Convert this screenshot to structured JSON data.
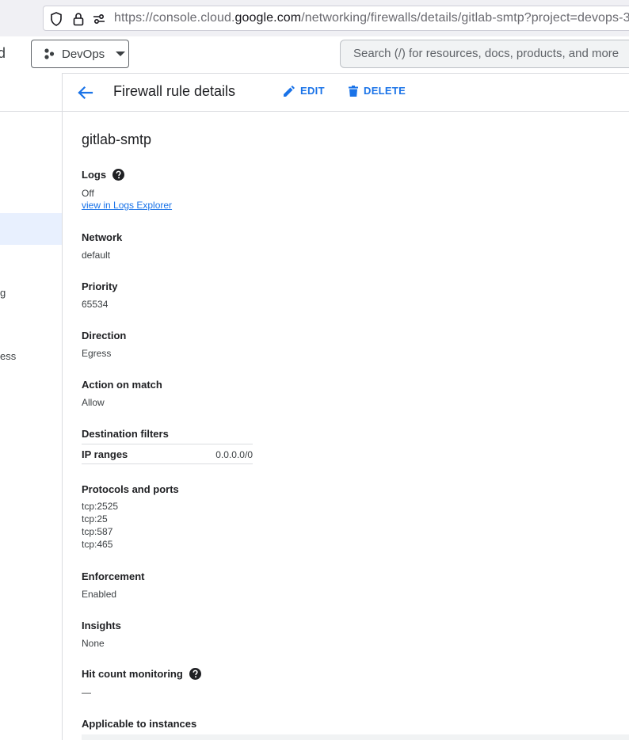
{
  "browser": {
    "url_prefix": "https://console.cloud.",
    "url_domain": "google.com",
    "url_suffix": "/networking/firewalls/details/gitlab-smtp?project=devops-3"
  },
  "header": {
    "truncated_brand": "d",
    "project_label": "DevOps",
    "search_placeholder": "Search (/) for resources, docs, products, and more"
  },
  "leftnav": {
    "fragments": [
      "g",
      "ess"
    ]
  },
  "titlebar": {
    "title": "Firewall rule details",
    "edit_label": "EDIT",
    "delete_label": "DELETE"
  },
  "rule": {
    "name": "gitlab-smtp",
    "logs_label": "Logs",
    "logs_value": "Off",
    "logs_link": "view in Logs Explorer",
    "network_label": "Network",
    "network_value": "default",
    "priority_label": "Priority",
    "priority_value": "65534",
    "direction_label": "Direction",
    "direction_value": "Egress",
    "action_label": "Action on match",
    "action_value": "Allow",
    "dest_filters_label": "Destination filters",
    "ip_ranges_key": "IP ranges",
    "ip_ranges_value": "0.0.0.0/0",
    "protocols_label": "Protocols and ports",
    "protocols": [
      "tcp:2525",
      "tcp:25",
      "tcp:587",
      "tcp:465"
    ],
    "enforcement_label": "Enforcement",
    "enforcement_value": "Enabled",
    "insights_label": "Insights",
    "insights_value": "None",
    "hit_count_label": "Hit count monitoring",
    "hit_count_value": "—",
    "instances_label": "Applicable to instances"
  }
}
